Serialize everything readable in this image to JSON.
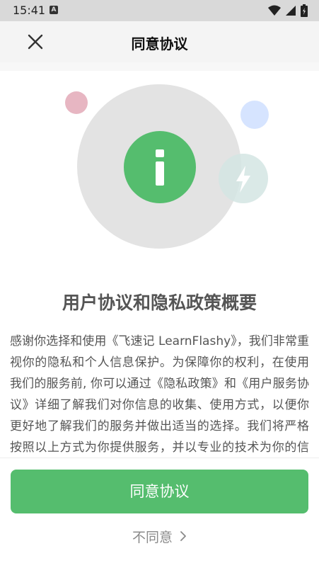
{
  "status_bar": {
    "time": "15:41",
    "notification_icon": "A"
  },
  "header": {
    "title": "同意协议"
  },
  "main": {
    "title": "用户协议和隐私政策概要",
    "body": "感谢你选择和使用《飞速记 LearnFlashy》，我们非常重视你的隐私和个人信息保护。为保障你的权利，在使用我们的服务前, 你可以通过《隐私政策》和《用户服务协议》详细了解我们对你信息的收集、使用方式，以便你更好地了解我们的服务并做出适当的选择。我们将严格按照以上方式为你提供服务，并以专业的技术为你的信息安全保驾护航。"
  },
  "actions": {
    "agree_label": "同意协议",
    "disagree_label": "不同意"
  },
  "colors": {
    "accent": "#55bd6e",
    "info_circle": "#55bd6e",
    "big_circle": "#e3e3e3",
    "pink_dot": "#e7b6c2",
    "blue_dot": "#d6e4ff",
    "teal_circle": "#d4e5e3"
  }
}
